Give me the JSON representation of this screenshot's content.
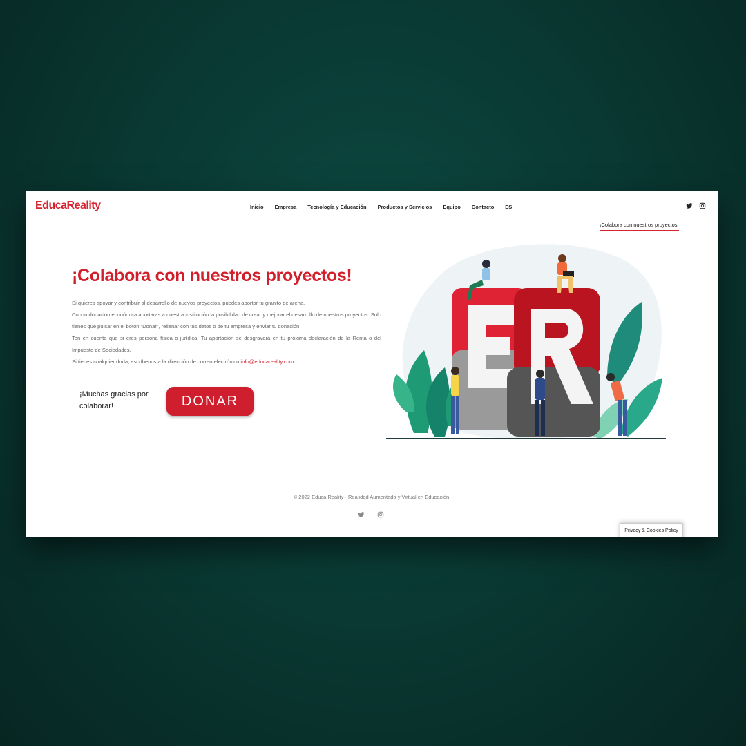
{
  "header": {
    "logo_part1": "Educa",
    "logo_part2": "Reality",
    "nav": [
      "Inicio",
      "Empresa",
      "Tecnología y Educación",
      "Productos y Servicios",
      "Equipo",
      "Contacto",
      "ES"
    ],
    "breadcrumb": "¡Colabora con nuestros proyectos!"
  },
  "main": {
    "title": "¡Colabora con nuestros proyectos!",
    "paragraphs": [
      "Si quieres apoyar y contribuir al desarrollo de nuevos proyectos, puedes aportar tu granito de arena.",
      "Con tu donación económica aportaras a nuestra institución la posibilidad de crear y mejorar el desarrollo de nuestros proyectos. Solo tienes que pulsar en el botón “Donar”, rellenar con tus datos o de tu empresa y enviar tu donación.",
      "Ten en cuenta que si eres persona física o jurídica. Tu aportación se desgravará en tu próxima declaración de la Renta o del Impuesto de Sociedades."
    ],
    "contact_prefix": "Si tienes cualquier duda, escríbenos a la dirección de correo electrónico ",
    "contact_email": "info@educareality.com",
    "contact_suffix": ".",
    "thanks": "¡Muchas gracias por colaborar!",
    "donate_label": "DONAR"
  },
  "illustration": {
    "letters": "ER",
    "colors": {
      "red": "#e02334",
      "dark_red": "#b9141f",
      "gray": "#9a9a9a",
      "dark_gray": "#555555",
      "green": "#1e9b74",
      "teal": "#1f8b7a"
    }
  },
  "footer": {
    "copyright": "© 2022 Educa Reality - Realidad Aumentada y Virtual en Educación.",
    "privacy": "Privacy & Cookies Policy"
  },
  "icons": [
    "twitter-icon",
    "instagram-icon"
  ]
}
